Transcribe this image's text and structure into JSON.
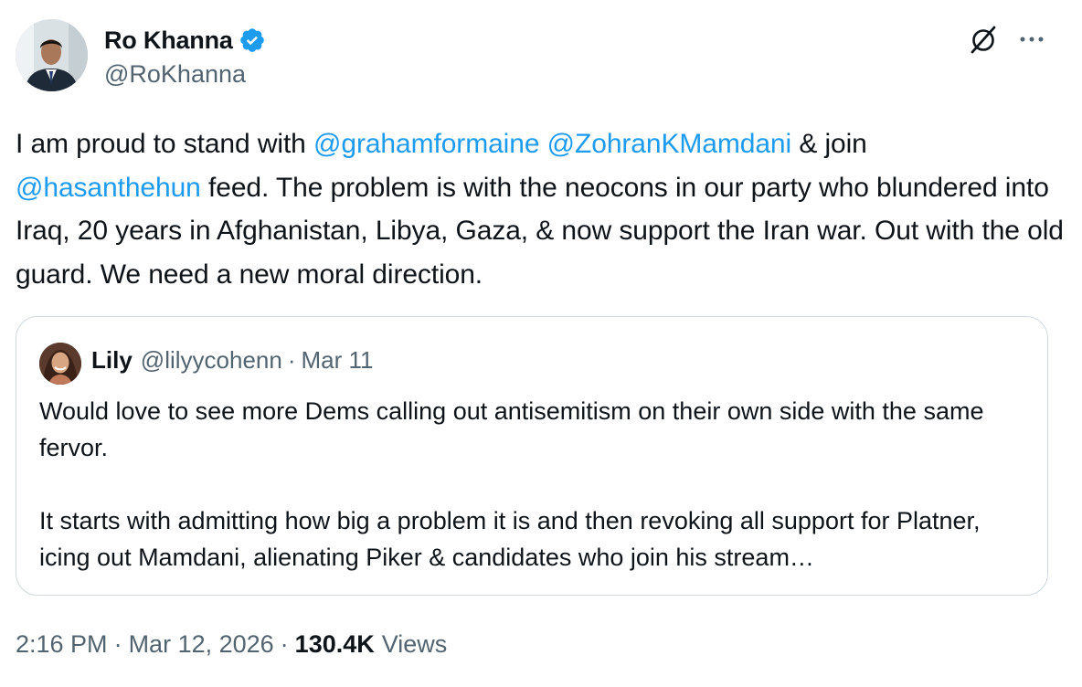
{
  "author": {
    "display_name": "Ro Khanna",
    "handle": "@RoKhanna",
    "verified_icon": "verified-badge-icon",
    "verified_color": "#1d9bf0"
  },
  "header_actions": {
    "grok_icon": "grok-icon",
    "more_icon": "more-options-icon"
  },
  "tweet": {
    "segments": [
      {
        "text": "I am proud to stand with ",
        "type": "text"
      },
      {
        "text": "@grahamformaine",
        "type": "mention"
      },
      {
        "text": " ",
        "type": "text"
      },
      {
        "text": "@ZohranKMamdani",
        "type": "mention"
      },
      {
        "text": " & join ",
        "type": "text"
      },
      {
        "text": "@hasanthehun",
        "type": "mention"
      },
      {
        "text": " feed. The problem is with the neocons in our party who blundered into Iraq, 20 years in Afghanistan, Libya, Gaza, & now support the Iran war. Out with the old guard. We need a new moral direction.",
        "type": "text"
      }
    ]
  },
  "quote": {
    "name": "Lily",
    "handle": "@lilyycohenn",
    "separator": "·",
    "date": "Mar 11",
    "paragraph1": "Would love to see more Dems calling out antisemitism on their own side with the same fervor.",
    "paragraph2": "It starts with admitting how big a problem it is and then revoking all support for Platner, icing out Mamdani, alienating Piker & candidates who join his stream…"
  },
  "meta": {
    "time": "2:16 PM",
    "separator": "·",
    "date": "Mar 12, 2026",
    "views_count": "130.4K",
    "views_label": "Views"
  },
  "colors": {
    "mention": "#1d9bf0",
    "secondary_text": "#536471",
    "primary_text": "#0f1419",
    "border": "#cfd9de"
  }
}
